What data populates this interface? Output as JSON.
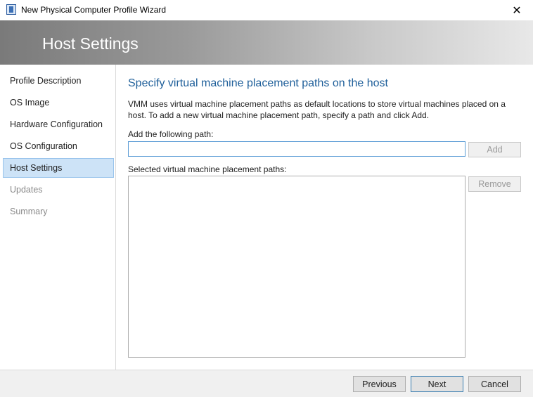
{
  "window": {
    "title": "New Physical Computer Profile Wizard",
    "close_glyph": "✕"
  },
  "banner": {
    "title": "Host Settings"
  },
  "sidebar": {
    "items": [
      {
        "label": "Profile Description",
        "state": "normal"
      },
      {
        "label": "OS Image",
        "state": "normal"
      },
      {
        "label": "Hardware Configuration",
        "state": "normal"
      },
      {
        "label": "OS Configuration",
        "state": "normal"
      },
      {
        "label": "Host Settings",
        "state": "active"
      },
      {
        "label": "Updates",
        "state": "disabled"
      },
      {
        "label": "Summary",
        "state": "disabled"
      }
    ]
  },
  "main": {
    "heading": "Specify virtual machine placement paths on the host",
    "description": "VMM uses virtual machine placement paths as default locations to store virtual machines placed on a host. To add a new virtual machine placement path, specify a path and click Add.",
    "add_path_label": "Add the following path:",
    "add_path_value": "",
    "add_button": "Add",
    "selected_label": "Selected virtual machine placement paths:",
    "remove_button": "Remove",
    "selected_paths": []
  },
  "footer": {
    "previous": "Previous",
    "next": "Next",
    "cancel": "Cancel"
  }
}
